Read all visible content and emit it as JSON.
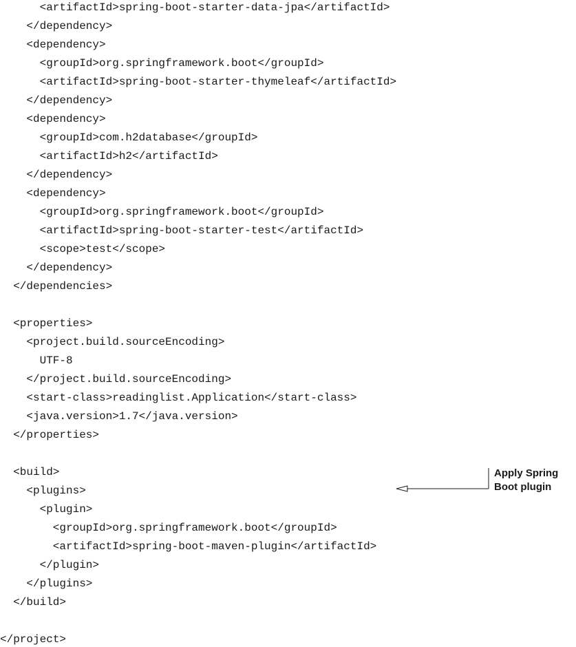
{
  "code_lines": [
    {
      "indent": 3,
      "text": "<artifactId>spring-boot-starter-data-jpa</artifactId>"
    },
    {
      "indent": 2,
      "text": "</dependency>"
    },
    {
      "indent": 2,
      "text": "<dependency>"
    },
    {
      "indent": 3,
      "text": "<groupId>org.springframework.boot</groupId>"
    },
    {
      "indent": 3,
      "text": "<artifactId>spring-boot-starter-thymeleaf</artifactId>"
    },
    {
      "indent": 2,
      "text": "</dependency>"
    },
    {
      "indent": 2,
      "text": "<dependency>"
    },
    {
      "indent": 3,
      "text": "<groupId>com.h2database</groupId>"
    },
    {
      "indent": 3,
      "text": "<artifactId>h2</artifactId>"
    },
    {
      "indent": 2,
      "text": "</dependency>"
    },
    {
      "indent": 2,
      "text": "<dependency>"
    },
    {
      "indent": 3,
      "text": "<groupId>org.springframework.boot</groupId>"
    },
    {
      "indent": 3,
      "text": "<artifactId>spring-boot-starter-test</artifactId>"
    },
    {
      "indent": 3,
      "text": "<scope>test</scope>"
    },
    {
      "indent": 2,
      "text": "</dependency>"
    },
    {
      "indent": 1,
      "text": "</dependencies>"
    },
    {
      "indent": 0,
      "text": ""
    },
    {
      "indent": 1,
      "text": "<properties>"
    },
    {
      "indent": 2,
      "text": "<project.build.sourceEncoding>"
    },
    {
      "indent": 3,
      "text": "UTF-8"
    },
    {
      "indent": 2,
      "text": "</project.build.sourceEncoding>"
    },
    {
      "indent": 2,
      "text": "<start-class>readinglist.Application</start-class>"
    },
    {
      "indent": 2,
      "text": "<java.version>1.7</java.version>"
    },
    {
      "indent": 1,
      "text": "</properties>"
    },
    {
      "indent": 0,
      "text": ""
    },
    {
      "indent": 1,
      "text": "<build>"
    },
    {
      "indent": 2,
      "text": "<plugins>"
    },
    {
      "indent": 3,
      "text": "<plugin>"
    },
    {
      "indent": 4,
      "text": "<groupId>org.springframework.boot</groupId>"
    },
    {
      "indent": 4,
      "text": "<artifactId>spring-boot-maven-plugin</artifactId>"
    },
    {
      "indent": 3,
      "text": "</plugin>"
    },
    {
      "indent": 2,
      "text": "</plugins>"
    },
    {
      "indent": 1,
      "text": "</build>"
    },
    {
      "indent": 0,
      "text": ""
    },
    {
      "indent": 0,
      "text": "</project>"
    }
  ],
  "annotation": {
    "line1": "Apply Spring",
    "line2": "Boot plugin"
  }
}
